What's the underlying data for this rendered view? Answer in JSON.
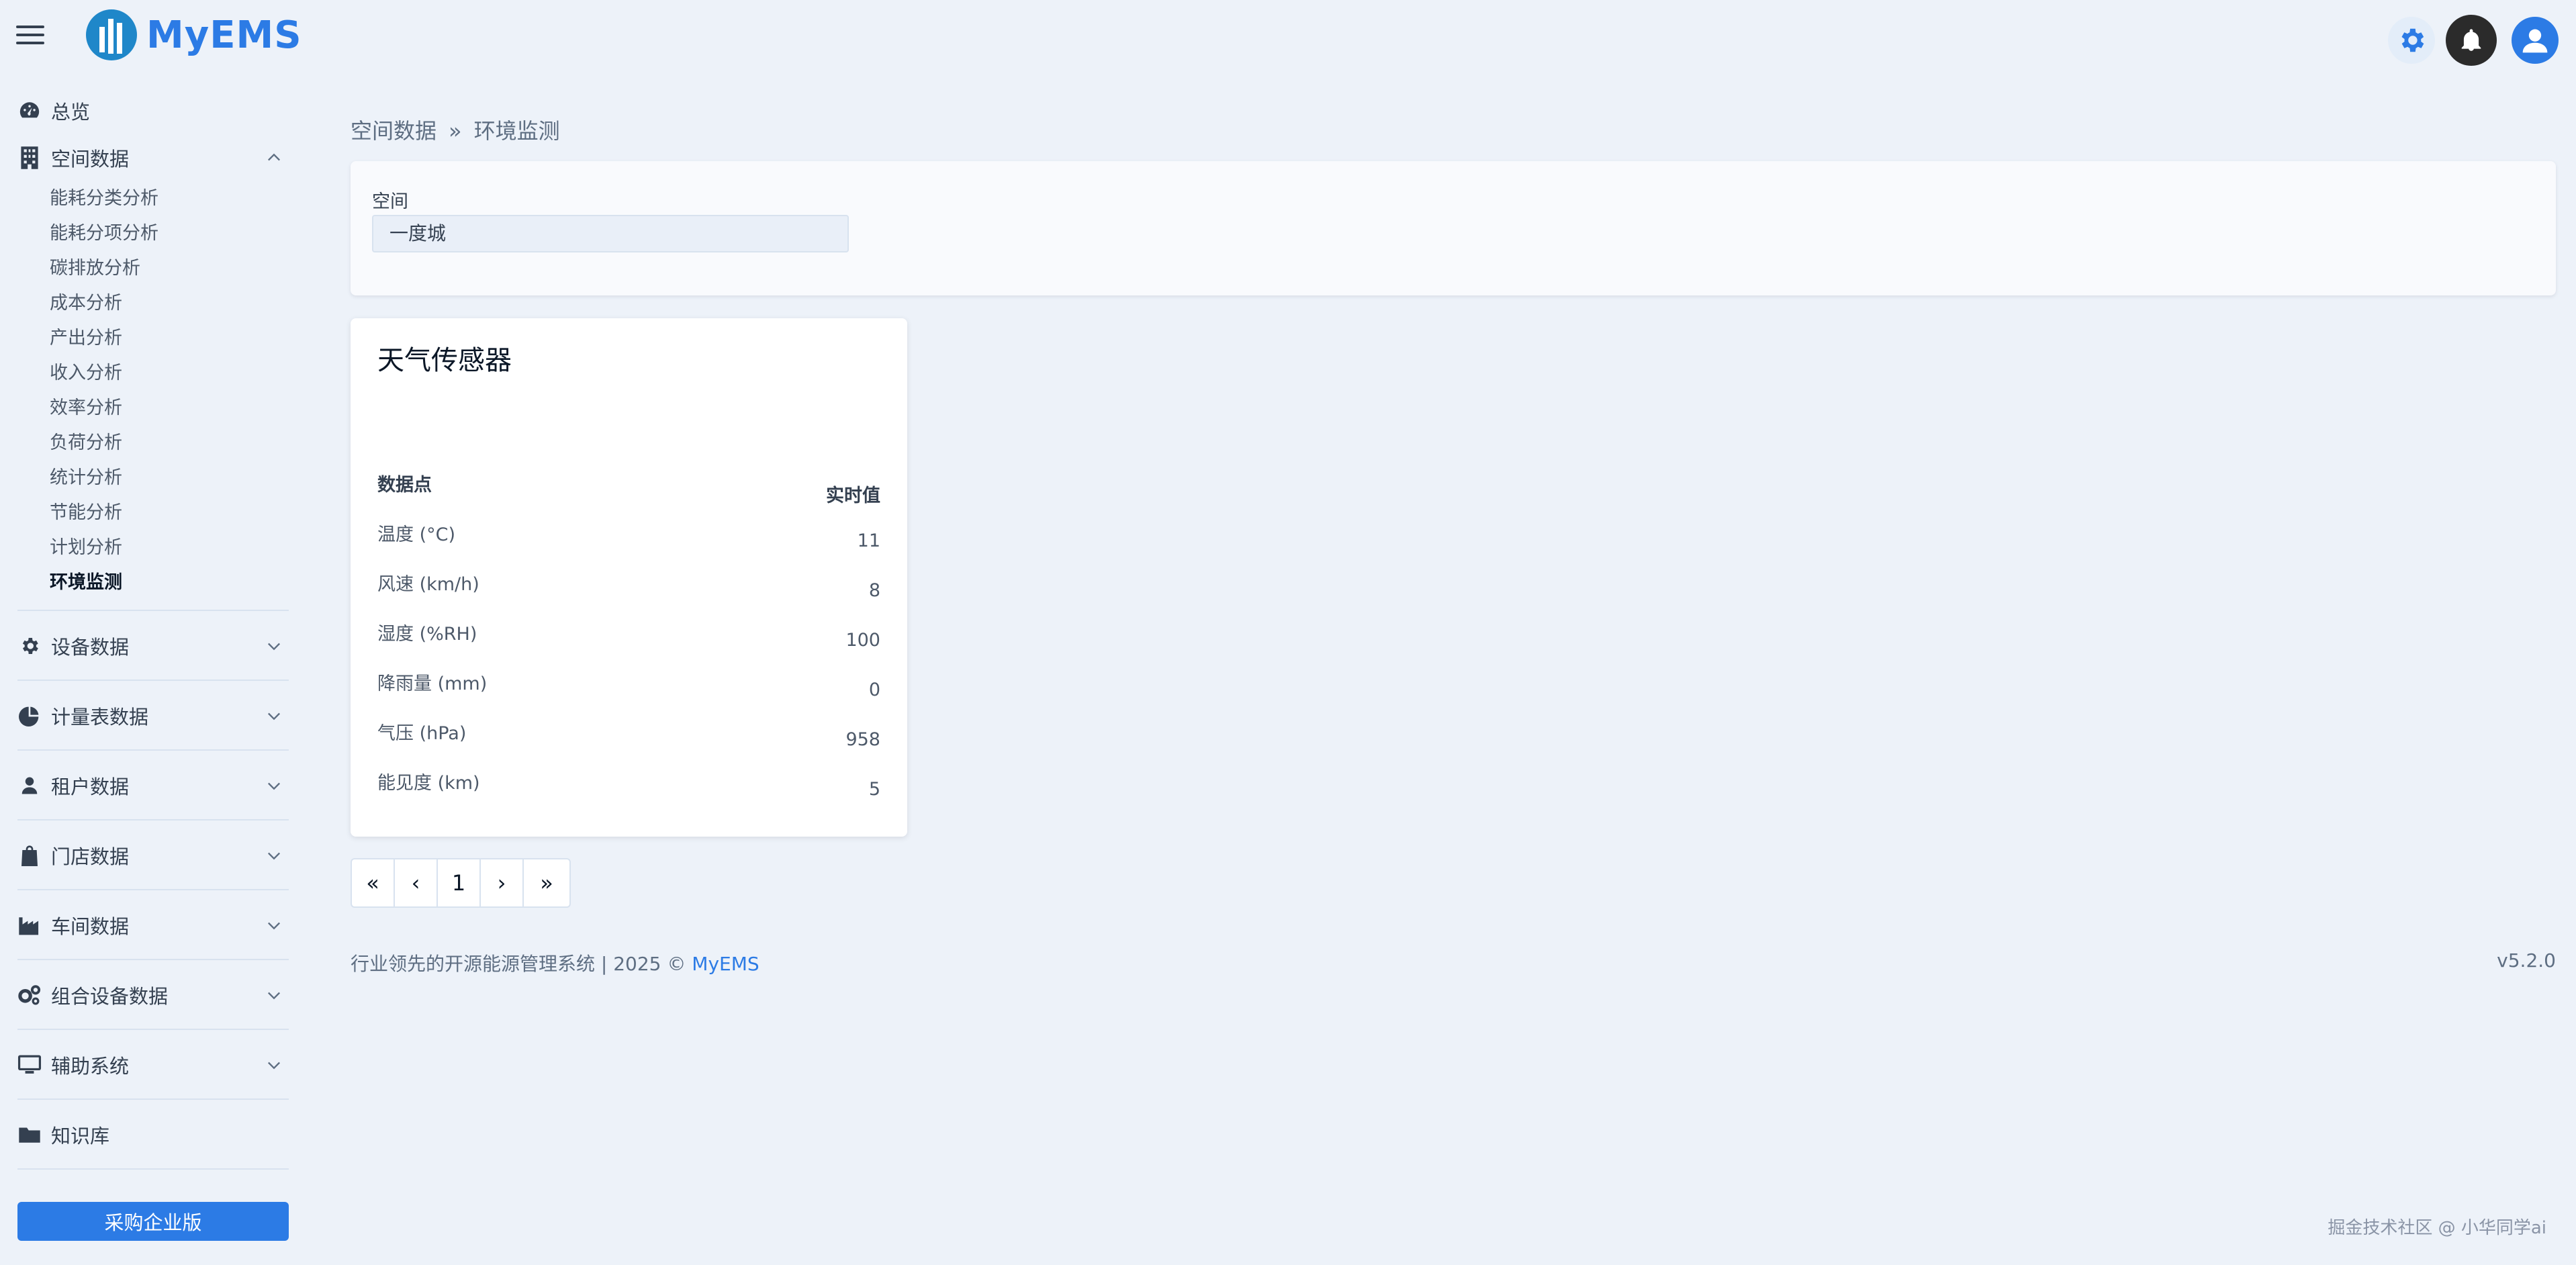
{
  "app": {
    "name": "MyEMS"
  },
  "sidebar": {
    "overview": "总览",
    "space_data": {
      "label": "空间数据",
      "items": [
        "能耗分类分析",
        "能耗分项分析",
        "碳排放分析",
        "成本分析",
        "产出分析",
        "收入分析",
        "效率分析",
        "负荷分析",
        "统计分析",
        "节能分析",
        "计划分析",
        "环境监测"
      ],
      "active_item": "环境监测"
    },
    "groups": [
      {
        "label": "设备数据",
        "icon": "gear-icon"
      },
      {
        "label": "计量表数据",
        "icon": "pie-chart-icon"
      },
      {
        "label": "租户数据",
        "icon": "user-icon"
      },
      {
        "label": "门店数据",
        "icon": "shopping-bag-icon"
      },
      {
        "label": "车间数据",
        "icon": "industry-icon"
      },
      {
        "label": "组合设备数据",
        "icon": "gears-icon"
      },
      {
        "label": "辅助系统",
        "icon": "desktop-icon"
      },
      {
        "label": "知识库",
        "icon": "folder-icon"
      }
    ],
    "buy_button": "采购企业版"
  },
  "breadcrumb": {
    "parent": "空间数据",
    "separator": "»",
    "current": "环境监测"
  },
  "filter": {
    "space_label": "空间",
    "space_value": "一度城"
  },
  "sensor_card": {
    "title": "天气传感器",
    "col_point": "数据点",
    "col_value": "实时值",
    "rows": [
      {
        "label": "温度 (°C)",
        "value": "11"
      },
      {
        "label": "风速 (km/h)",
        "value": "8"
      },
      {
        "label": "湿度 (%RH)",
        "value": "100"
      },
      {
        "label": "降雨量 (mm)",
        "value": "0"
      },
      {
        "label": "气压 (hPa)",
        "value": "958"
      },
      {
        "label": "能见度 (km)",
        "value": "5"
      }
    ]
  },
  "pagination": {
    "first": "«",
    "prev": "‹",
    "page": "1",
    "next": "›",
    "last": "»"
  },
  "footer": {
    "text": "行业领先的开源能源管理系统 | 2025 © ",
    "brand": "MyEMS",
    "version": "v5.2.0"
  },
  "watermark": "掘金技术社区 @ 小华同学ai",
  "colors": {
    "accent": "#2c7be5",
    "background": "#edf2f9"
  }
}
